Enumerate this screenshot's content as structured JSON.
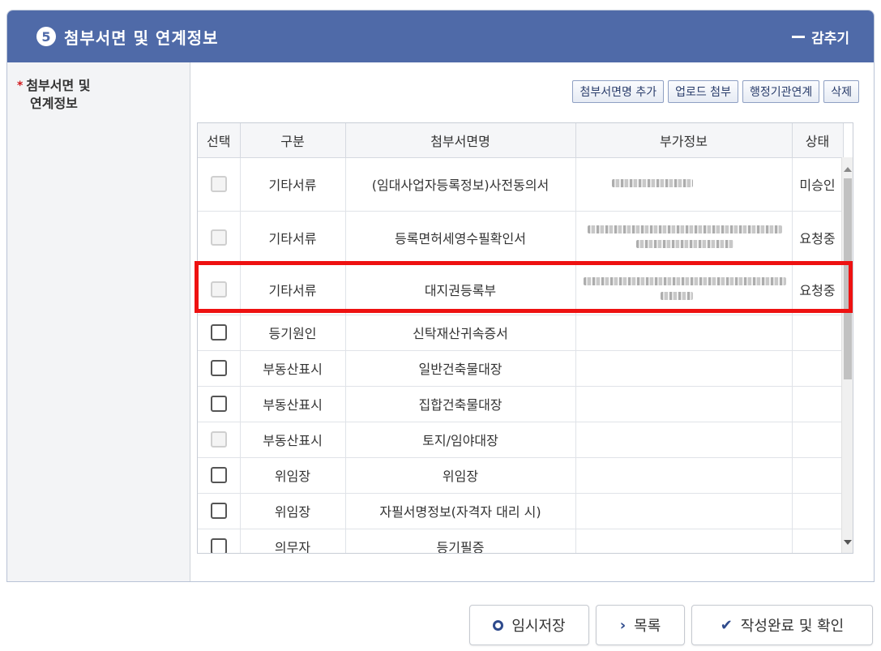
{
  "section": {
    "number": "5",
    "title": "첨부서면 및 연계정보",
    "collapse_label": "감추기"
  },
  "side_label": {
    "line1": "첨부서면 및",
    "line2": "연계정보",
    "required_mark": "*"
  },
  "toolbar": {
    "add_name": "첨부서면명 추가",
    "upload": "업로드 첨부",
    "agency_link": "행정기관연계",
    "delete": "삭제"
  },
  "table": {
    "headers": [
      "선택",
      "구분",
      "첨부서면명",
      "부가정보",
      "상태"
    ],
    "rows": [
      {
        "checkbox_enabled": false,
        "category": "기타서류",
        "name": "(임대사업자등록정보)사전동의서",
        "status": "미승인",
        "has_extra": true
      },
      {
        "checkbox_enabled": false,
        "category": "기타서류",
        "name": "등록면허세영수필확인서",
        "status": "요청중",
        "has_extra": true
      },
      {
        "checkbox_enabled": false,
        "category": "기타서류",
        "name": "대지권등록부",
        "status": "요청중",
        "has_extra": true
      },
      {
        "checkbox_enabled": true,
        "category": "등기원인",
        "name": "신탁재산귀속증서",
        "status": "",
        "has_extra": false
      },
      {
        "checkbox_enabled": true,
        "category": "부동산표시",
        "name": "일반건축물대장",
        "status": "",
        "has_extra": false
      },
      {
        "checkbox_enabled": true,
        "category": "부동산표시",
        "name": "집합건축물대장",
        "status": "",
        "has_extra": false
      },
      {
        "checkbox_enabled": false,
        "category": "부동산표시",
        "name": "토지/임야대장",
        "status": "",
        "has_extra": false
      },
      {
        "checkbox_enabled": true,
        "category": "위임장",
        "name": "위임장",
        "status": "",
        "has_extra": false
      },
      {
        "checkbox_enabled": true,
        "category": "위임장",
        "name": "자필서명정보(자격자 대리 시)",
        "status": "",
        "has_extra": false
      },
      {
        "checkbox_enabled": true,
        "category": "의무자",
        "name": "등기필증",
        "status": "",
        "has_extra": false
      }
    ]
  },
  "footer": {
    "temp_save": "임시저장",
    "list": "목록",
    "complete": "작성완료 및 확인"
  },
  "colors": {
    "header_bg": "#4f6aa8",
    "highlight": "#ee1111"
  }
}
